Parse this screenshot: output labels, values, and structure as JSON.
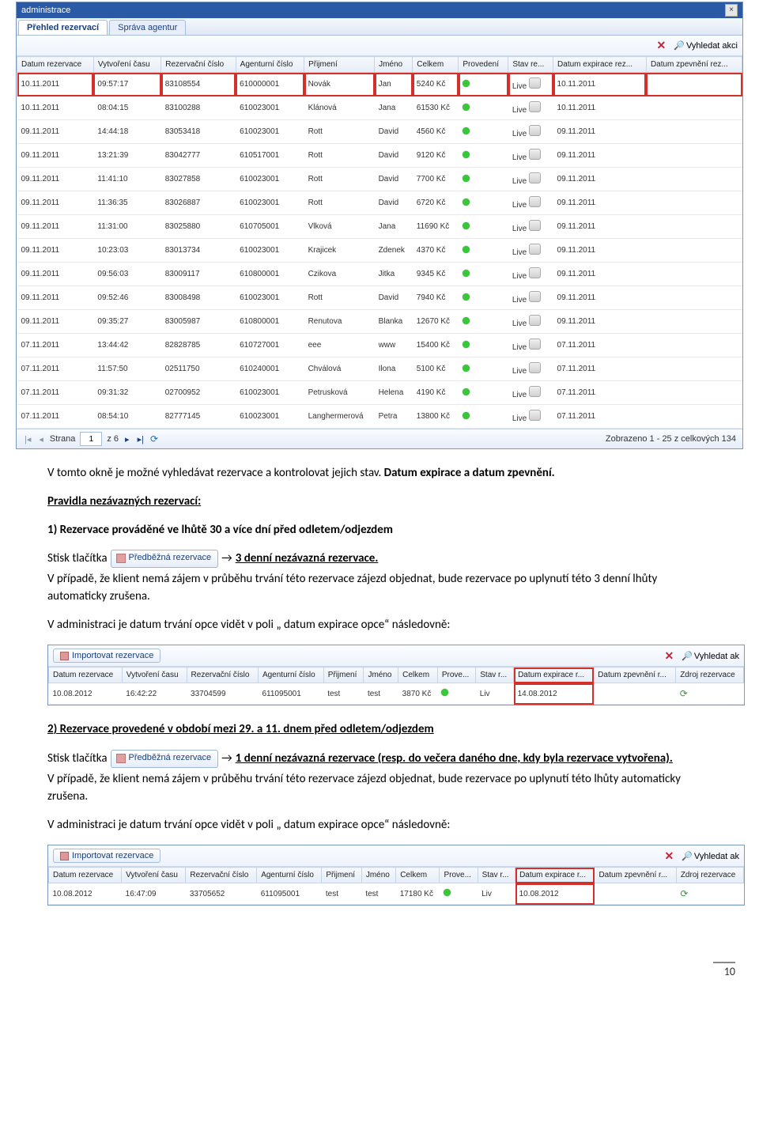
{
  "titlebar": "administrace",
  "tabs": [
    "Přehled rezervací",
    "Správa agentur"
  ],
  "import_btn": "Importovat rezervace",
  "search_btn": "Vyhledat akci",
  "search_btn_small": "Vyhledat ak",
  "grid1": {
    "headers": [
      "Datum rezervace",
      "Vytvoření času",
      "Rezervační číslo",
      "Agenturní číslo",
      "Přijmení",
      "Jméno",
      "Celkem",
      "Provedení",
      "Stav re...",
      "Datum expirace rez...",
      "Datum zpevnění rez..."
    ],
    "rows": [
      {
        "date": "10.11.2011",
        "time": "09:57:17",
        "res": "83108554",
        "agent": "610000001",
        "surname": "Novák",
        "name": "Jan",
        "total": "5240 Kč",
        "live": "Live",
        "exp": "10.11.2011",
        "hl": true
      },
      {
        "date": "10.11.2011",
        "time": "08:04:15",
        "res": "83100288",
        "agent": "610023001",
        "surname": "Klánová",
        "name": "Jana",
        "total": "61530 Kč",
        "live": "Live",
        "exp": "10.11.2011"
      },
      {
        "date": "09.11.2011",
        "time": "14:44:18",
        "res": "83053418",
        "agent": "610023001",
        "surname": "Rott",
        "name": "David",
        "total": "4560 Kč",
        "live": "Live",
        "exp": "09.11.2011"
      },
      {
        "date": "09.11.2011",
        "time": "13:21:39",
        "res": "83042777",
        "agent": "610517001",
        "surname": "Rott",
        "name": "David",
        "total": "9120 Kč",
        "live": "Live",
        "exp": "09.11.2011"
      },
      {
        "date": "09.11.2011",
        "time": "11:41:10",
        "res": "83027858",
        "agent": "610023001",
        "surname": "Rott",
        "name": "David",
        "total": "7700 Kč",
        "live": "Live",
        "exp": "09.11.2011"
      },
      {
        "date": "09.11.2011",
        "time": "11:36:35",
        "res": "83026887",
        "agent": "610023001",
        "surname": "Rott",
        "name": "David",
        "total": "6720 Kč",
        "live": "Live",
        "exp": "09.11.2011"
      },
      {
        "date": "09.11.2011",
        "time": "11:31:00",
        "res": "83025880",
        "agent": "610705001",
        "surname": "Vlková",
        "name": "Jana",
        "total": "11690 Kč",
        "live": "Live",
        "exp": "09.11.2011"
      },
      {
        "date": "09.11.2011",
        "time": "10:23:03",
        "res": "83013734",
        "agent": "610023001",
        "surname": "Krajicek",
        "name": "Zdenek",
        "total": "4370 Kč",
        "live": "Live",
        "exp": "09.11.2011"
      },
      {
        "date": "09.11.2011",
        "time": "09:56:03",
        "res": "83009117",
        "agent": "610800001",
        "surname": "Czikova",
        "name": "Jitka",
        "total": "9345 Kč",
        "live": "Live",
        "exp": "09.11.2011"
      },
      {
        "date": "09.11.2011",
        "time": "09:52:46",
        "res": "83008498",
        "agent": "610023001",
        "surname": "Rott",
        "name": "David",
        "total": "7940 Kč",
        "live": "Live",
        "exp": "09.11.2011"
      },
      {
        "date": "09.11.2011",
        "time": "09:35:27",
        "res": "83005987",
        "agent": "610800001",
        "surname": "Renutova",
        "name": "Blanka",
        "total": "12670 Kč",
        "live": "Live",
        "exp": "09.11.2011"
      },
      {
        "date": "07.11.2011",
        "time": "13:44:42",
        "res": "82828785",
        "agent": "610727001",
        "surname": "eee",
        "name": "www",
        "total": "15400 Kč",
        "live": "Live",
        "exp": "07.11.2011"
      },
      {
        "date": "07.11.2011",
        "time": "11:57:50",
        "res": "02511750",
        "agent": "610240001",
        "surname": "Chválová",
        "name": "Ilona",
        "total": "5100 Kč",
        "live": "Live",
        "exp": "07.11.2011"
      },
      {
        "date": "07.11.2011",
        "time": "09:31:32",
        "res": "02700952",
        "agent": "610023001",
        "surname": "Petrusková",
        "name": "Helena",
        "total": "4190 Kč",
        "live": "Live",
        "exp": "07.11.2011"
      },
      {
        "date": "07.11.2011",
        "time": "08:54:10",
        "res": "82777145",
        "agent": "610023001",
        "surname": "Langhermerová",
        "name": "Petra",
        "total": "13800 Kč",
        "live": "Live",
        "exp": "07.11.2011"
      }
    ],
    "pager": {
      "strana": "Strana",
      "page": "1",
      "of": "z 6",
      "summary": "Zobrazeno 1 - 25 z celkových 134"
    }
  },
  "grid2": {
    "headers": [
      "Datum rezervace",
      "Vytvoření času",
      "Rezervační číslo",
      "Agenturní číslo",
      "Přijmení",
      "Jméno",
      "Celkem",
      "Prove...",
      "Stav r...",
      "Datum expirace r...",
      "Datum zpevnění r...",
      "Zdroj rezervace"
    ],
    "row": {
      "date": "10.08.2012",
      "time": "16:42:22",
      "res": "33704599",
      "agent": "611095001",
      "surname": "test",
      "name": "test",
      "total": "3870 Kč",
      "live": "Liv",
      "exp": "14.08.2012"
    }
  },
  "grid3": {
    "headers": [
      "Datum rezervace",
      "Vytvoření času",
      "Rezervační číslo",
      "Agenturní číslo",
      "Přijmení",
      "Jméno",
      "Celkem",
      "Prove...",
      "Stav r...",
      "Datum expirace r...",
      "Datum zpevnění r...",
      "Zdroj rezervace"
    ],
    "row": {
      "date": "10.08.2012",
      "time": "16:47:09",
      "res": "33705652",
      "agent": "611095001",
      "surname": "test",
      "name": "test",
      "total": "17180 Kč",
      "live": "Liv",
      "exp": "10.08.2012"
    }
  },
  "text": {
    "p1a": "V tomto okně je možné vyhledávat rezervace a kontrolovat jejich stav. ",
    "p1b": "Datum expirace a datum zpevnění.",
    "p2": "Pravidla nezávazných rezervací:",
    "p3": "1) Rezervace prováděné ve lhůtě 30 a více dní před odletem/odjezdem",
    "stisk": "Stisk tlačítka",
    "prebtn": "Předběžná rezervace",
    "arrow": "→ ",
    "r3": "3 denní nezávazná rezervace.",
    "p4": " V případě, že klient nemá zájem v průběhu trvání této rezervace zájezd objednat, bude rezervace po uplynutí této 3 denní lhůty automaticky zrušena.",
    "p5": "V administraci je datum trvání opce vidět v poli „ datum expirace opce“ následovně:",
    "p6": "2) Rezervace provedené v období  mezi 29. a 11. dnem před odletem/odjezdem",
    "r1": "1 denní nezávazná rezervace (resp. do večera daného dne, kdy byla rezervace vytvořena).",
    "p7": " V případě, že klient nemá zájem v průběhu trvání této rezervace zájezd objednat, bude rezervace po uplynutí této lhůty automaticky zrušena.",
    "p8": "V administraci je datum trvání opce vidět v poli „ datum expirace opce“ následovně:"
  },
  "page_num": "10"
}
